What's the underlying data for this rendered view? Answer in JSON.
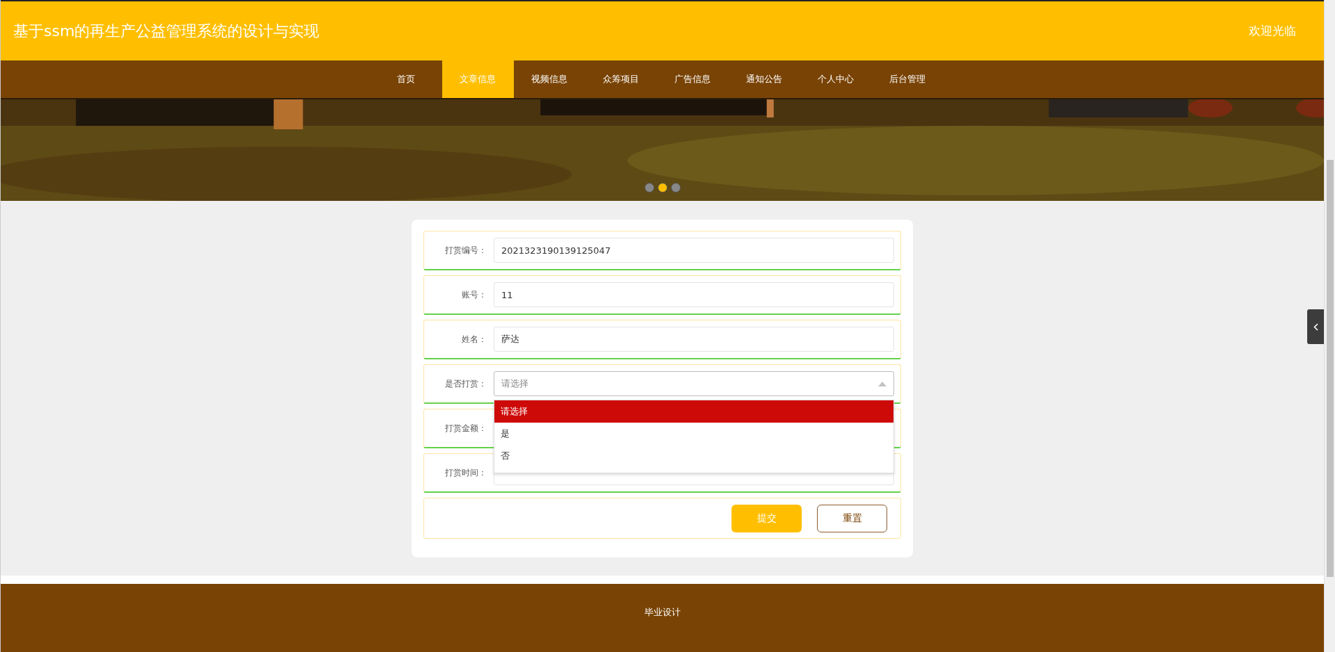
{
  "header": {
    "title": "基于ssm的再生产公益管理系统的设计与实现",
    "welcome": "欢迎光临"
  },
  "nav": [
    {
      "label": "首页",
      "selected": false
    },
    {
      "label": "文章信息",
      "selected": true
    },
    {
      "label": "视频信息",
      "selected": false
    },
    {
      "label": "众筹项目",
      "selected": false
    },
    {
      "label": "广告信息",
      "selected": false
    },
    {
      "label": "通知公告",
      "selected": false
    },
    {
      "label": "个人中心",
      "selected": false
    },
    {
      "label": "后台管理",
      "selected": false
    }
  ],
  "banner": {
    "kind": "picture",
    "dots": [
      {
        "selected": false
      },
      {
        "selected": true
      },
      {
        "selected": false
      }
    ]
  },
  "form": {
    "fields": [
      {
        "kind": "text",
        "label": "打赏编号：",
        "value": "2021323190139125047"
      },
      {
        "kind": "text",
        "label": "账号：",
        "value": "11"
      },
      {
        "kind": "text",
        "label": "姓名：",
        "value": "萨达"
      },
      {
        "kind": "select",
        "label": "是否打赏：",
        "placeholder": "请选择",
        "expanded": true,
        "options": [
          {
            "label": "请选择",
            "selected": true
          },
          {
            "label": "是",
            "selected": false
          },
          {
            "label": "否",
            "selected": false
          }
        ]
      },
      {
        "kind": "text",
        "label": "打赏金额："
      },
      {
        "kind": "text",
        "label": "打赏时间："
      }
    ],
    "buttons": [
      {
        "kind": "primary",
        "label": "提交"
      },
      {
        "kind": "outline",
        "label": "重置"
      }
    ]
  },
  "footer": {
    "text": "毕业设计"
  }
}
